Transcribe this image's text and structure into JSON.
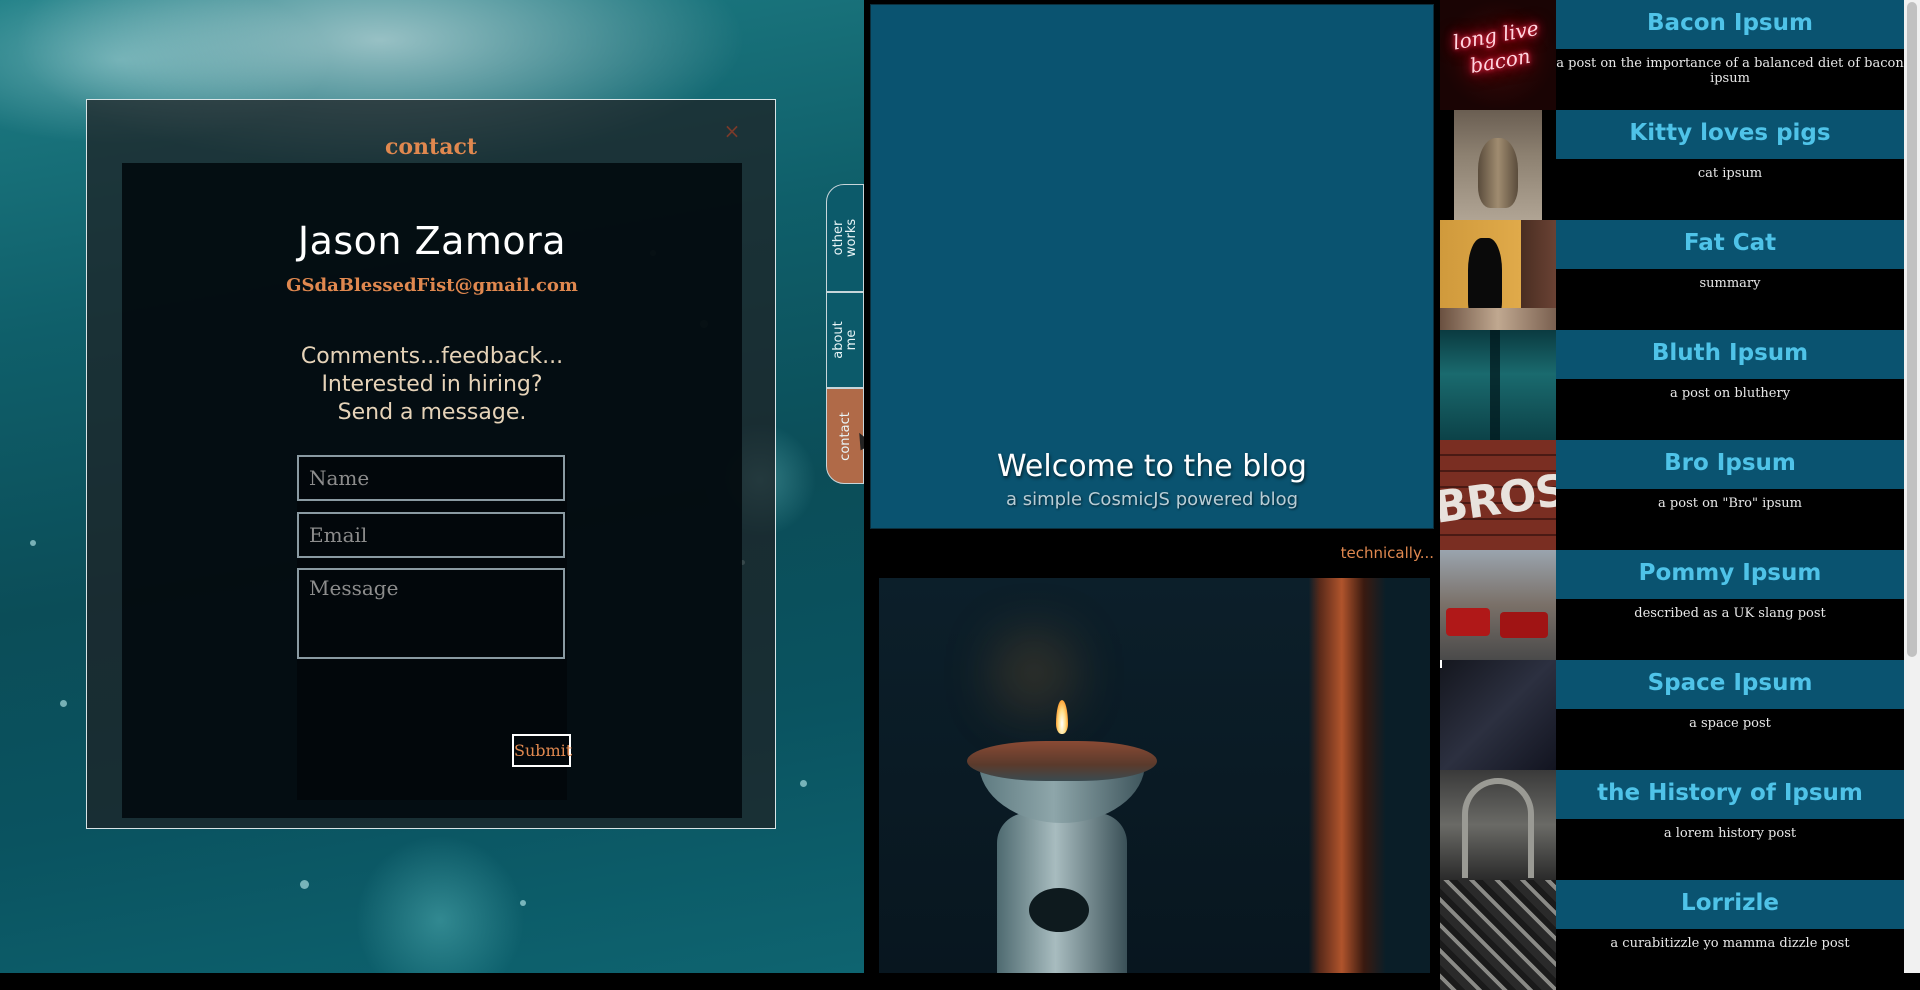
{
  "contact": {
    "title": "contact",
    "close_symbol": "×",
    "name": "Jason Zamora",
    "email": "GSdaBlessedFist@gmail.com",
    "prompt_line1": "Comments...feedback...",
    "prompt_line2": "Interested in hiring?",
    "prompt_line3": "Send a message.",
    "name_placeholder": "Name",
    "email_placeholder": "Email",
    "message_placeholder": "Message",
    "submit_label": "Submit"
  },
  "side_tabs": [
    {
      "label_line1": "other",
      "label_line2": "works"
    },
    {
      "label_line1": "about",
      "label_line2": "me"
    },
    {
      "label_line1": "contact",
      "label_line2": ""
    }
  ],
  "blog": {
    "title": "Welcome to the blog",
    "subtitle": "a simple CosmicJS powered blog",
    "tagline": "technically..."
  },
  "posts": [
    {
      "title": "Bacon Ipsum",
      "summary": "a post on the importance of a balanced diet of bacon ipsum",
      "thumb_text": "long live bacon"
    },
    {
      "title": "Kitty loves pigs",
      "summary": "cat ipsum"
    },
    {
      "title": "Fat Cat",
      "summary": "summary"
    },
    {
      "title": "Bluth Ipsum",
      "summary": "a post on bluthery"
    },
    {
      "title": "Bro Ipsum",
      "summary": "a post on \"Bro\" ipsum",
      "thumb_text": "BROS"
    },
    {
      "title": "Pommy Ipsum",
      "summary": "described as a UK slang post"
    },
    {
      "title": "Space Ipsum",
      "summary": "a space post"
    },
    {
      "title": "the History of Ipsum",
      "summary": "a lorem history post"
    },
    {
      "title": "Lorrizle",
      "summary": "a curabitizzle yo mamma dizzle post"
    }
  ],
  "colors": {
    "accent": "#e0884f",
    "title_blue": "#4fc3e8",
    "header_bg": "#0a5370"
  }
}
